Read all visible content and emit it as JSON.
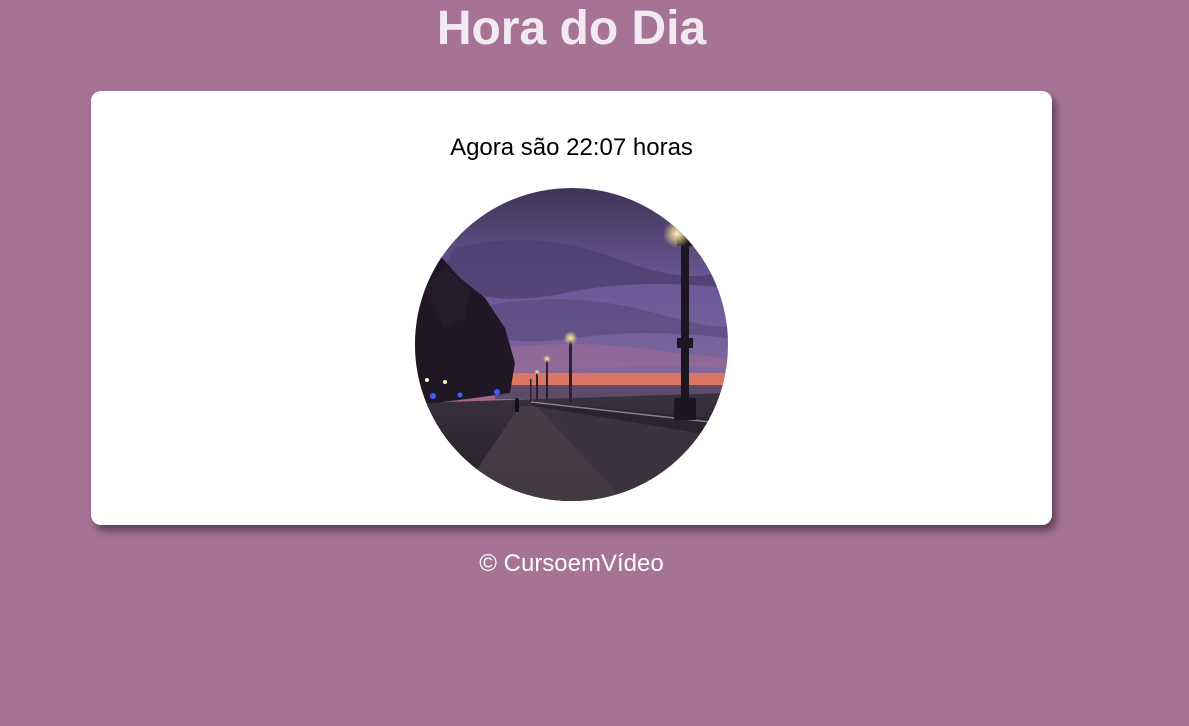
{
  "header": {
    "title": "Hora do Dia"
  },
  "card": {
    "message": "Agora são 22:07 horas",
    "image_icon": "night-promenade-photo"
  },
  "footer": {
    "text": "© CursoemVídeo"
  },
  "colors": {
    "background": "#a67397",
    "card": "#ffffff",
    "title": "#f3e9f1",
    "footer": "#ffffff"
  }
}
